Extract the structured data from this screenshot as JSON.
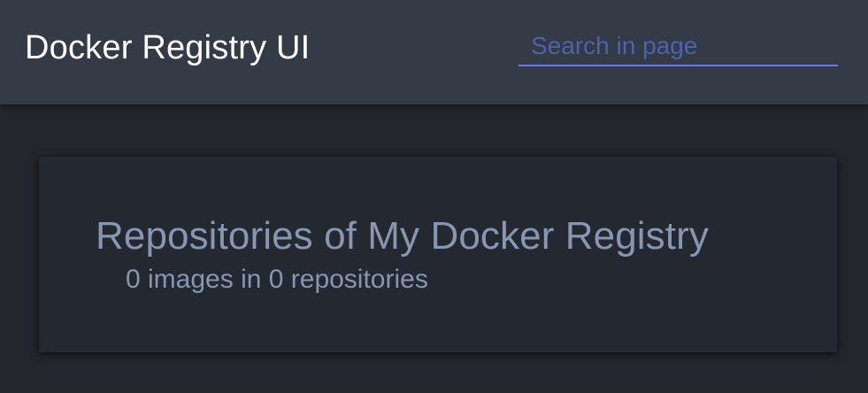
{
  "header": {
    "title": "Docker Registry UI",
    "search": {
      "placeholder": "Search in page",
      "value": ""
    }
  },
  "catalog": {
    "title": "Repositories of My Docker Registry",
    "summary": "0 images in 0 repositories"
  },
  "colors": {
    "header_bg": "#343a46",
    "page_bg": "#23262d",
    "card_bg": "#242830",
    "accent": "#5d80df",
    "title_text": "#ffffff",
    "muted_text": "#8796b1"
  }
}
